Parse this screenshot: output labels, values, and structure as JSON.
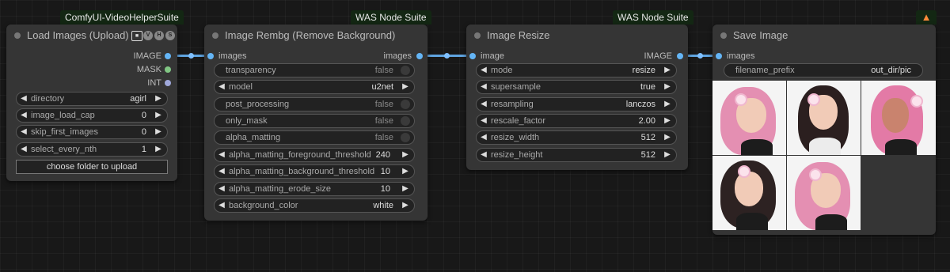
{
  "colors": {
    "canvas": "#181818",
    "node_bg": "#353535",
    "wire": "#60a4e0",
    "tag_bg": "#132713",
    "image_slot": "#64b5f6",
    "mask_slot": "#81c784",
    "int_slot": "#9fa8da"
  },
  "tags": {
    "vhs": "ComfyUI-VideoHelperSuite",
    "was1": "WAS Node Suite",
    "was2": "WAS Node Suite",
    "fox_icon": "fox-icon"
  },
  "load_images": {
    "title": "Load Images (Upload)",
    "outputs": [
      "IMAGE",
      "MASK",
      "INT"
    ],
    "badges": [
      "V",
      "H",
      "S"
    ],
    "widgets": [
      {
        "label": "directory",
        "value": "agirl"
      },
      {
        "label": "image_load_cap",
        "value": "0"
      },
      {
        "label": "skip_first_images",
        "value": "0"
      },
      {
        "label": "select_every_nth",
        "value": "1"
      }
    ],
    "upload_button": "choose folder to upload"
  },
  "rembg": {
    "title": "Image Rembg (Remove Background)",
    "input": "images",
    "output": "images",
    "widgets": [
      {
        "label": "transparency",
        "value": "false"
      },
      {
        "label": "model",
        "value": "u2net"
      },
      {
        "label": "post_processing",
        "value": "false"
      },
      {
        "label": "only_mask",
        "value": "false"
      },
      {
        "label": "alpha_matting",
        "value": "false"
      },
      {
        "label": "alpha_matting_foreground_threshold",
        "value": "240"
      },
      {
        "label": "alpha_matting_background_threshold",
        "value": "10"
      },
      {
        "label": "alpha_matting_erode_size",
        "value": "10"
      },
      {
        "label": "background_color",
        "value": "white"
      }
    ]
  },
  "resize": {
    "title": "Image Resize",
    "input": "image",
    "output": "IMAGE",
    "widgets": [
      {
        "label": "mode",
        "value": "resize"
      },
      {
        "label": "supersample",
        "value": "true"
      },
      {
        "label": "resampling",
        "value": "lanczos"
      },
      {
        "label": "rescale_factor",
        "value": "2.00"
      },
      {
        "label": "resize_width",
        "value": "512"
      },
      {
        "label": "resize_height",
        "value": "512"
      }
    ]
  },
  "save": {
    "title": "Save Image",
    "input": "images",
    "filename_label": "filename_prefix",
    "filename_value": "out_dir/pic"
  }
}
